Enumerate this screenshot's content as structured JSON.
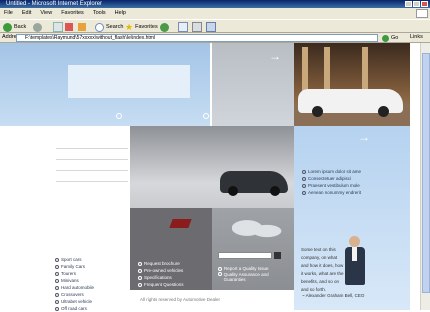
{
  "window": {
    "title": "Untitled - Microsoft Internet Explorer"
  },
  "menu": [
    "File",
    "Edit",
    "View",
    "Favorites",
    "Tools",
    "Help"
  ],
  "toolbar": {
    "back_label": "Back",
    "search_label": "Search",
    "favorites_label": "Favorites"
  },
  "address": {
    "label": "Address",
    "url": "F:\\templates\\Raymund\\57xxxxx\\without_flash\\Ie\\index.html",
    "go_label": "Go",
    "links_label": "Links"
  },
  "site": {
    "promo_items": [
      "Lorem ipsum dolor sit ame",
      "Consectetuer adipisci",
      "Praesent vestibulum mole",
      "Aenean nonummy endrerit"
    ],
    "nav_items": [
      "Sport cars",
      "Family Cars",
      "Tourers",
      "Minivans",
      "Hard automobile",
      "Crossovers",
      "Ultrabet vehicle",
      "Off road cars"
    ],
    "service_links": [
      "Request brochure",
      "Pre-owned vehicles",
      "Specifications",
      "Frequent Questions"
    ],
    "quality_links": [
      "Report a Quality Issue",
      "Quality Assurance and Guaranties"
    ],
    "quote": "Some text on this company, on what and how it does, how it works, what are the benefits, and so on and so forth.",
    "quote_author": "~ Alexander Graham Bell, CEO",
    "footer": "All rights reserved by Automotive Dealer"
  },
  "colors": {
    "xp_blue": "#0a246a",
    "sky": "#bcd7f0",
    "gray_panel": "#b5b8bc",
    "dark_panel": "#6f6f72"
  }
}
